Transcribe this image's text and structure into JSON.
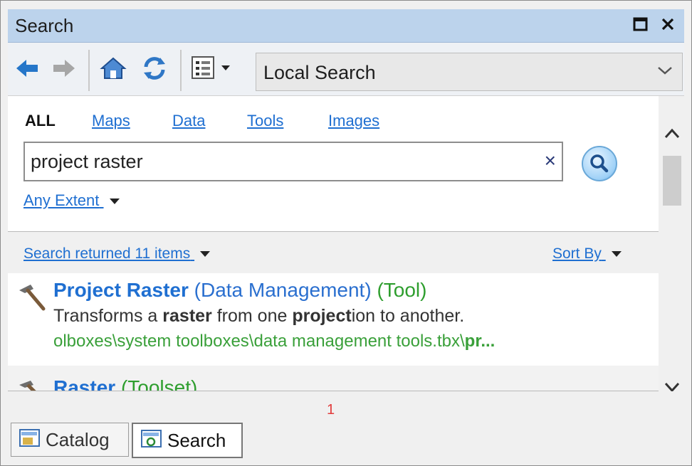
{
  "window": {
    "title": "Search",
    "controls": [
      "restore",
      "close"
    ]
  },
  "toolbar": {
    "icons": [
      "back-arrow-icon",
      "forward-arrow-icon",
      "home-icon",
      "refresh-icon",
      "view-options-icon"
    ],
    "search_scope": "Local Search"
  },
  "search": {
    "categories": [
      "ALL",
      "Maps",
      "Data",
      "Tools",
      "Images"
    ],
    "selected_category": "ALL",
    "query": "project raster",
    "clear_label": "×",
    "extent_label": "Any Extent"
  },
  "results": {
    "summary": "Search returned 11 items",
    "sort_label": "Sort By",
    "items": [
      {
        "name": "Project Raster",
        "category": "(Data Management)",
        "kind": "(Tool)",
        "desc_parts": [
          "Transforms a ",
          "raster",
          " from one ",
          "project",
          "ion to another."
        ],
        "path": "olboxes\\system toolboxes\\data management tools.tbx\\",
        "path_bold": "pr..."
      },
      {
        "name": "Raster",
        "kind": "(Toolset)"
      }
    ]
  },
  "annotation": "1",
  "tabs": [
    {
      "label": "Catalog",
      "active": false
    },
    {
      "label": "Search",
      "active": true
    }
  ],
  "colors": {
    "link": "#1f6fd1",
    "tool_green": "#2e9e2e",
    "title_bar": "#bcd3ec"
  }
}
